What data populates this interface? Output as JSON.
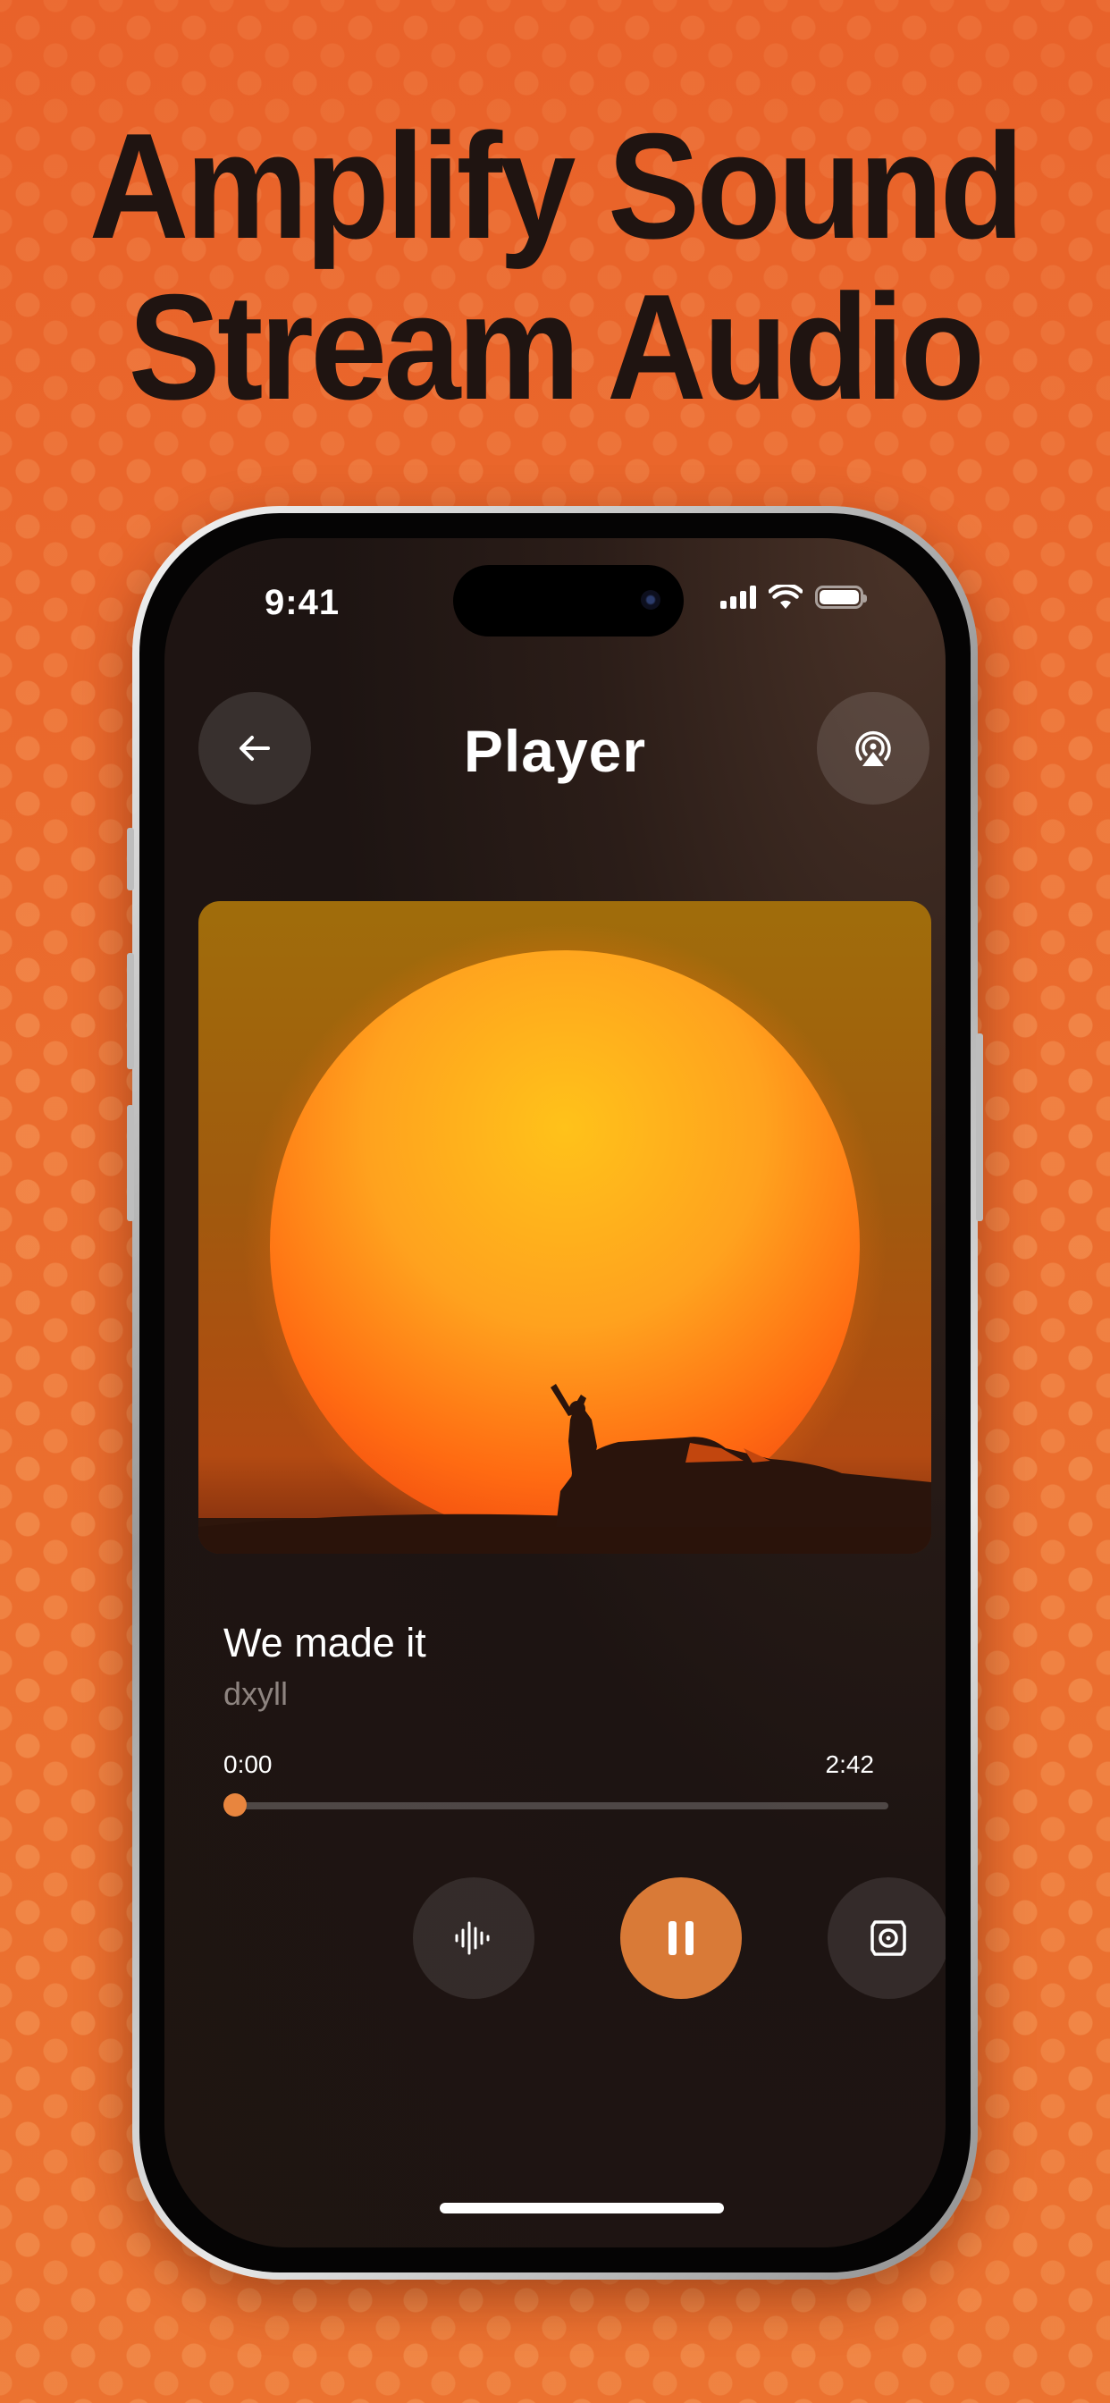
{
  "headline": {
    "line1": "Amplify Sound",
    "line2": "Stream Audio"
  },
  "status_bar": {
    "time": "9:41"
  },
  "header": {
    "title": "Player"
  },
  "track": {
    "title": "We made it",
    "artist": "dxyll"
  },
  "playback": {
    "elapsed": "0:00",
    "duration": "2:42",
    "progress": 0.0
  },
  "colors": {
    "background": "#ea6a2e",
    "accent": "#d97a37",
    "screen": "#1f1511"
  },
  "icons": {
    "back": "arrow-left-icon",
    "airplay": "airplay-broadcast-icon",
    "waveform": "waveform-icon",
    "pause": "pause-icon",
    "speaker": "speaker-icon"
  }
}
